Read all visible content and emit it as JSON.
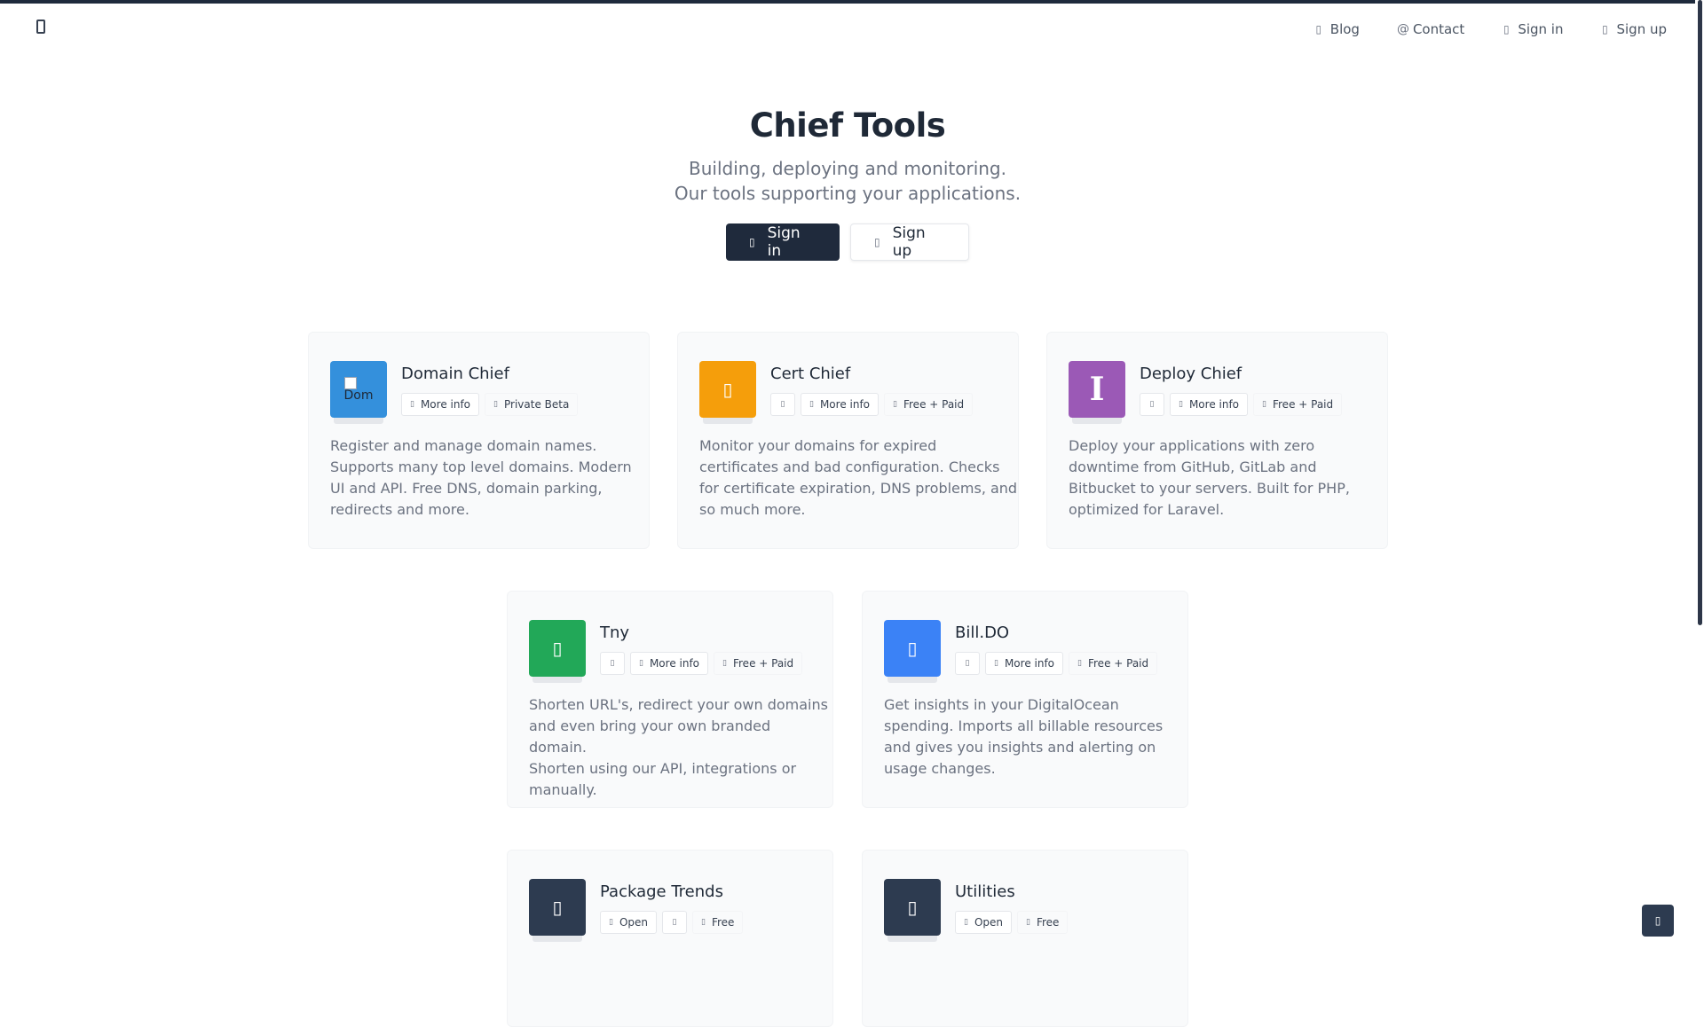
{
  "nav": {
    "blog": {
      "label": "Blog",
      "icon": "rss-icon"
    },
    "contact": {
      "label": "Contact",
      "icon": "at-icon"
    },
    "signin": {
      "label": "Sign in",
      "icon": "sign-in-icon"
    },
    "signup": {
      "label": "Sign up",
      "icon": "user-plus-icon"
    }
  },
  "hero": {
    "title": "Chief Tools",
    "subtitle_line1": "Building, deploying and monitoring.",
    "subtitle_line2": "Our tools supporting your applications.",
    "signin_label": "Sign in",
    "signup_label": "Sign up"
  },
  "cards": [
    {
      "title": "Domain Chief",
      "icon_alt": "Dom",
      "color": "#3490dc",
      "tags": [
        "More info",
        "Private Beta"
      ],
      "desc_lines": [
        "Register and manage domain names.",
        "Supports many top level domains. Modern",
        "UI and API. Free DNS, domain parking,",
        "redirects and more."
      ]
    },
    {
      "title": "Cert Chief",
      "color": "#f59e0b",
      "tags": [
        "More info",
        "Free + Paid"
      ],
      "desc_lines": [
        "Monitor your domains for expired",
        "certificates and bad configuration. Checks",
        "for certificate expiration, DNS problems, and",
        "so much more."
      ]
    },
    {
      "title": "Deploy Chief",
      "icon_glyph": "I",
      "color": "#9b59b6",
      "tags": [
        "More info",
        "Free + Paid"
      ],
      "desc_lines": [
        "Deploy your applications with zero",
        "downtime from GitHub, GitLab and",
        "Bitbucket to your servers. Built for PHP,",
        "optimized for Laravel."
      ]
    },
    {
      "title": "Tny",
      "color": "#22a858",
      "tags": [
        "More info",
        "Free + Paid"
      ],
      "desc_lines": [
        "Shorten URL's, redirect your own domains",
        "and even bring your own branded domain.",
        "Shorten using our API, integrations or",
        "manually."
      ]
    },
    {
      "title": "Bill.DO",
      "color": "#3b82f6",
      "tags": [
        "More info",
        "Free + Paid"
      ],
      "desc_lines": [
        "Get insights in your DigitalOcean",
        "spending. Imports all billable resources",
        "and gives you insights and alerting on",
        "usage changes."
      ]
    },
    {
      "title": "Package Trends",
      "color": "#2d3b50",
      "tags": [
        "Open",
        "Free"
      ]
    },
    {
      "title": "Utilities",
      "color": "#2d3b50",
      "tags": [
        "Open",
        "Free"
      ]
    }
  ]
}
